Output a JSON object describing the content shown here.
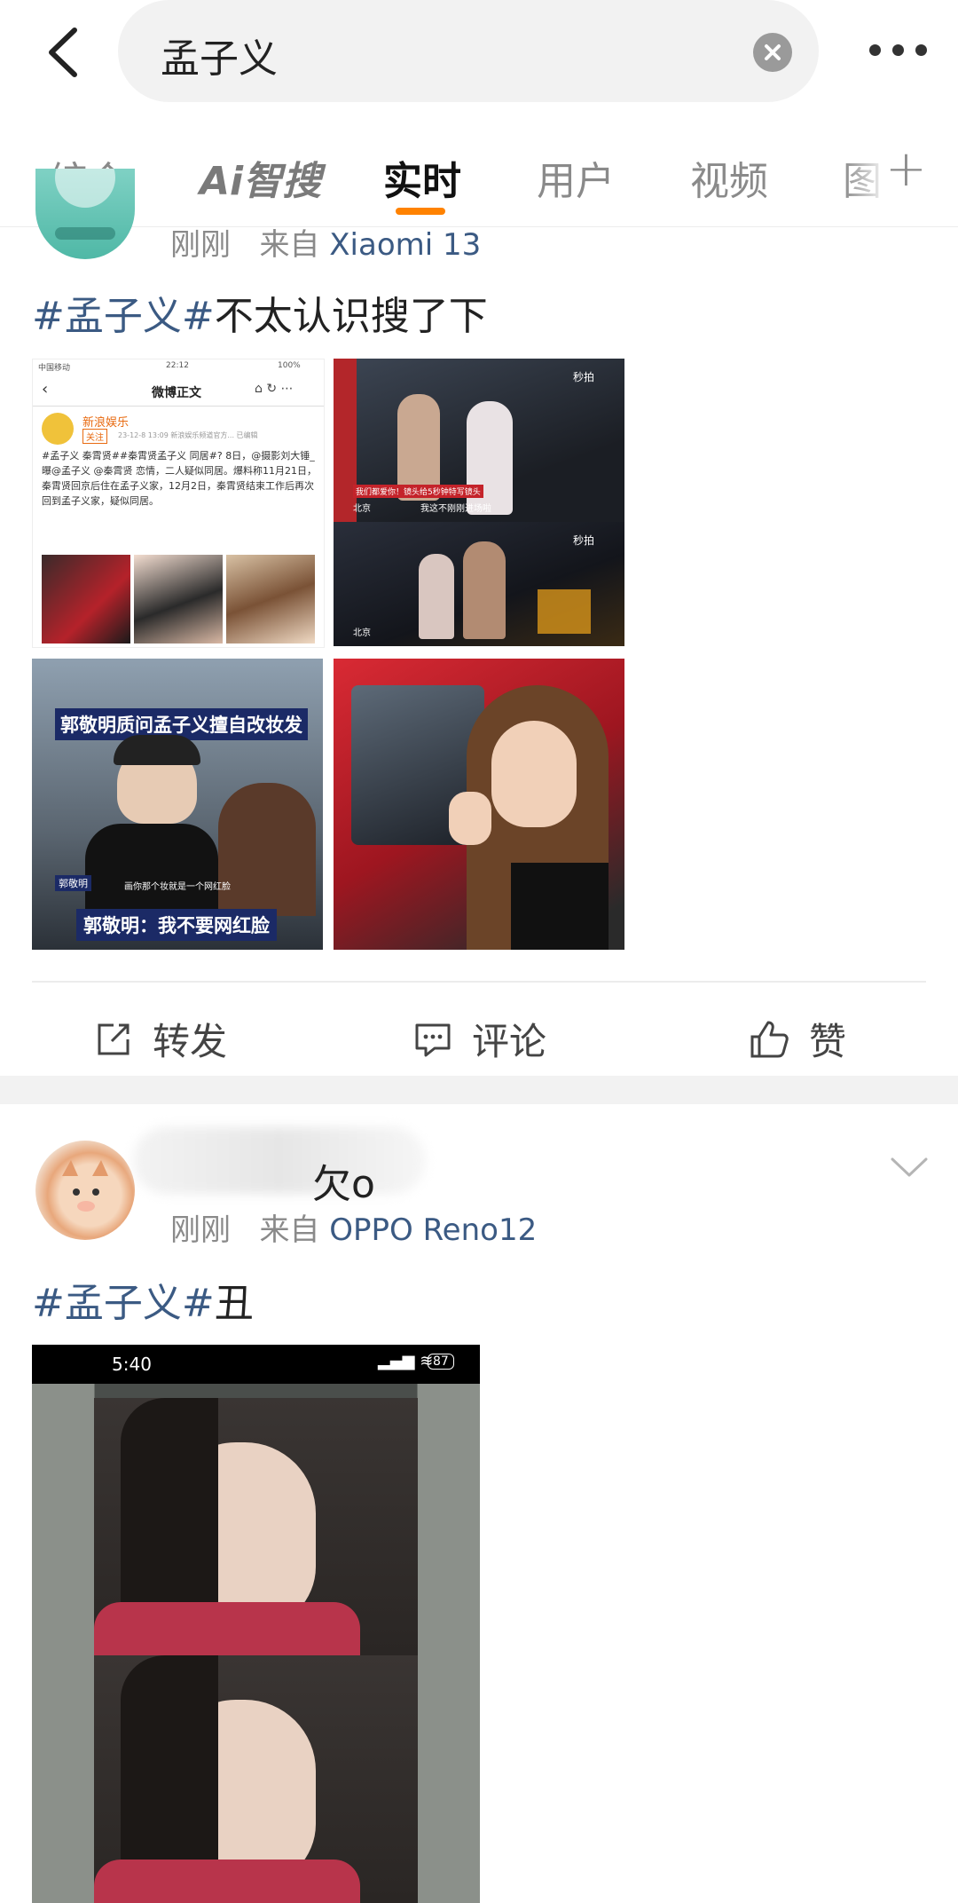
{
  "search": {
    "query": "孟子义"
  },
  "tabs": [
    {
      "label": "综合"
    },
    {
      "label": "智搜",
      "prefix": "Ai"
    },
    {
      "label": "实时",
      "active": true
    },
    {
      "label": "用户"
    },
    {
      "label": "视频"
    },
    {
      "label": "图"
    }
  ],
  "colors": {
    "accent": "#ff8200",
    "link": "#3b5a83",
    "muted": "#8a8a8a"
  },
  "posts": [
    {
      "meta_time": "刚刚",
      "meta_from": "来自",
      "meta_device": "Xiaomi 13",
      "topic": "#孟子义#",
      "text": "不太认识搜了下",
      "images": {
        "screenshot": {
          "status_left": "中国移动",
          "status_time": "22:12",
          "status_right": "100%",
          "title": "微博正文",
          "account": "新浪娱乐",
          "follow_badge": "关注",
          "post_meta": "23-12-8 13:09  新浪娱乐频道官方...  已编辑",
          "post_body": "#孟子义 秦霄贤##秦霄贤孟子义 同居#? 8日，@摄影刘大锤_ 曝@孟子义 @秦霄贤 恋情，二人疑似同居。爆料称11月21日，秦霄贤回京后住在孟子义家，12月2日，秦霄贤结束工作后再次回到孟子义家，疑似同居。"
        },
        "photo2": {
          "watermark": "秒拍",
          "caption_red": "我们都爱你！镜头给5秒钟特写镜头",
          "caption_bottom": "我这不刚刚进场啦",
          "city": "北京"
        },
        "photo3": {
          "title": "郭敬明质问孟子义擅自改妆发",
          "name_tag": "郭敬明",
          "subtitle": "画你那个妆就是一个网红脸",
          "caption": "郭敬明：我不要网红脸"
        }
      },
      "actions": {
        "repost": "转发",
        "comment": "评论",
        "like": "赞"
      }
    },
    {
      "name_tail": "欠o",
      "meta_time": "刚刚",
      "meta_from": "来自",
      "meta_device": "OPPO Reno12",
      "topic": "#孟子义#",
      "text": "丑",
      "image": {
        "status_time": "5:40",
        "battery": "87"
      }
    }
  ]
}
